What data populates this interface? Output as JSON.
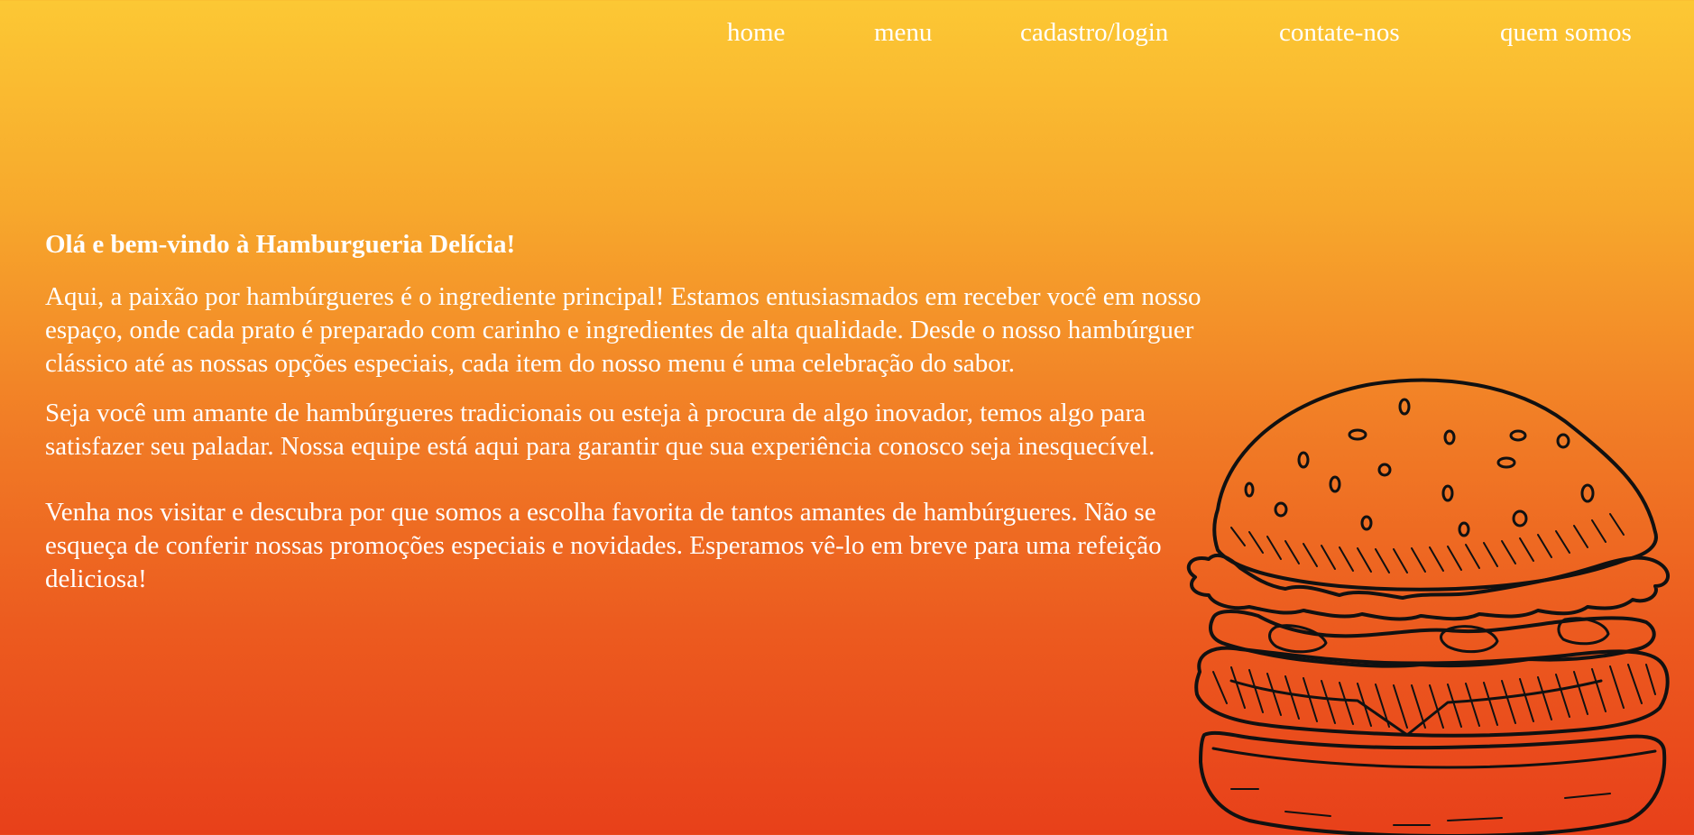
{
  "nav": {
    "items": [
      {
        "label": "home"
      },
      {
        "label": "menu"
      },
      {
        "label": "cadastro/login"
      },
      {
        "label": "contate-nos"
      },
      {
        "label": "quem somos"
      }
    ]
  },
  "main": {
    "title": "Olá e bem-vindo à Hamburgueria Delícia!",
    "paragraphs": [
      "Aqui, a paixão por hambúrgueres é o ingrediente principal! Estamos entusiasmados em receber você em nosso espaço, onde cada prato é preparado com carinho e ingredientes de alta qualidade. Desde o nosso hambúrguer clássico até as nossas opções especiais, cada item do nosso menu é uma celebração do sabor.",
      "Seja você um amante de hambúrgueres tradicionais ou esteja à procura de algo inovador, temos algo para satisfazer seu paladar. Nossa equipe está aqui para garantir que sua experiência conosco seja inesquecível.",
      "Venha nos visitar e descubra por que somos a escolha favorita de tantos amantes de hambúrgueres. Não se esqueça de conferir nossas promoções especiais e novidades. Esperamos vê-lo em breve para uma refeição deliciosa!"
    ]
  },
  "hero": {
    "icon": "hamburger-illustration"
  },
  "colors": {
    "gradient_top": "#fcc834",
    "gradient_bottom": "#e8401a",
    "text": "#ffffff",
    "illustration_stroke": "#111111"
  }
}
